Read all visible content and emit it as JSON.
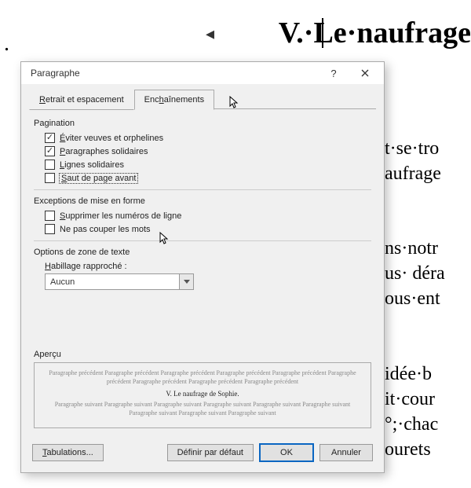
{
  "doc": {
    "dot": ".",
    "title": "V.·Le·naufrage",
    "para1": "t·se·tro\naufrage",
    "para2": "ns·notr\nus· déra\nous·ent",
    "para3": "idée·b\nit·cour\n°;·chac\nourets"
  },
  "dialog": {
    "title": "Paragraphe",
    "help": "?",
    "tabs": {
      "indent": {
        "pre": "R",
        "rest": "etrait et espacement"
      },
      "chain": {
        "pre": "Enc",
        "u": "h",
        "rest": "aînements"
      }
    },
    "pagination": {
      "label": "Pagination",
      "widows": {
        "pre": "É",
        "rest": "viter veuves et orphelines",
        "checked": true
      },
      "keepnext": {
        "pre": "P",
        "rest": "aragraphes solidaires",
        "checked": true
      },
      "keeplines": {
        "pre": "L",
        "rest": "ignes solidaires",
        "checked": false
      },
      "pagebreak": {
        "pre": "S",
        "rest": "aut de page avant",
        "checked": false
      }
    },
    "exceptions": {
      "label": "Exceptions de mise en forme",
      "suppress": {
        "pre": "S",
        "rest": "upprimer les numéros de ligne",
        "checked": false
      },
      "nohyphen": {
        "text": "Ne pas couper les mots",
        "checked": false
      }
    },
    "textbox": {
      "label": "Options de zone de texte",
      "tight": {
        "pre": "H",
        "rest": "abillage rapproché :"
      },
      "value": "Aucun"
    },
    "preview": {
      "label": "Aperçu",
      "before": "Paragraphe précédent Paragraphe précédent Paragraphe précédent Paragraphe précédent Paragraphe précédent Paragraphe précédent Paragraphe précédent Paragraphe précédent Paragraphe précédent",
      "mid": "V. Le naufrage de Sophie.",
      "after": "Paragraphe suivant Paragraphe suivant Paragraphe suivant Paragraphe suivant Paragraphe suivant Paragraphe suivant Paragraphe suivant Paragraphe suivant Paragraphe suivant"
    },
    "footer": {
      "tabs": {
        "pre": "T",
        "rest": "abulations..."
      },
      "default": "Définir par défaut",
      "ok": "OK",
      "cancel": "Annuler"
    }
  }
}
